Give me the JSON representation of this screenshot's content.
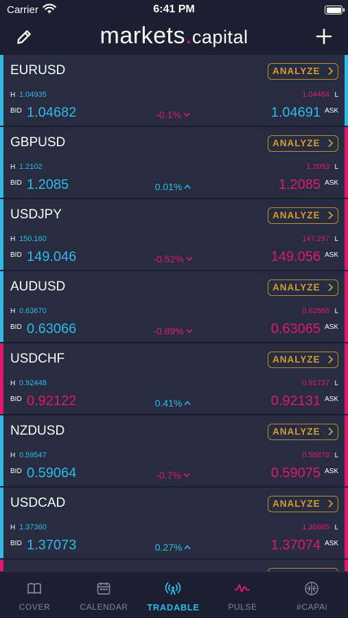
{
  "status": {
    "carrier": "Carrier",
    "time": "6:41 PM"
  },
  "header": {
    "logo_main": "markets",
    "logo_dot": ".",
    "logo_sub": "capital",
    "edit_icon": "pencil-icon",
    "add_icon": "plus-icon"
  },
  "colors": {
    "up": "#33b7e6",
    "down": "#e4186a",
    "accent": "#d99a30"
  },
  "labels": {
    "analyze": "ANALYZE",
    "high": "H",
    "low": "L",
    "bid": "BID",
    "ask": "ASK"
  },
  "pairs": [
    {
      "symbol": "EURUSD",
      "high": "1.04935",
      "low": "1.04484",
      "bid": "1.04682",
      "ask": "1.04691",
      "change": "-0.1%",
      "dir": "down",
      "bid_color": "up",
      "ask_color": "up",
      "left_bar": "up",
      "right_bar": "up"
    },
    {
      "symbol": "GBPUSD",
      "high": "1.2102",
      "low": "1.2053",
      "bid": "1.2085",
      "ask": "1.2085",
      "change": "0.01%",
      "dir": "up",
      "bid_color": "up",
      "ask_color": "down",
      "left_bar": "up",
      "right_bar": "down"
    },
    {
      "symbol": "USDJPY",
      "high": "150.160",
      "low": "147.297",
      "bid": "149.046",
      "ask": "149.056",
      "change": "-0.52%",
      "dir": "down",
      "bid_color": "up",
      "ask_color": "down",
      "left_bar": "up",
      "right_bar": "down"
    },
    {
      "symbol": "AUDUSD",
      "high": "0.63670",
      "low": "0.62868",
      "bid": "0.63066",
      "ask": "0.63065",
      "change": "-0.89%",
      "dir": "down",
      "bid_color": "up",
      "ask_color": "down",
      "left_bar": "up",
      "right_bar": "down"
    },
    {
      "symbol": "USDCHF",
      "high": "0.92448",
      "low": "0.91737",
      "bid": "0.92122",
      "ask": "0.92131",
      "change": "0.41%",
      "dir": "up",
      "bid_color": "down",
      "ask_color": "down",
      "left_bar": "down",
      "right_bar": "down"
    },
    {
      "symbol": "NZDUSD",
      "high": "0.59547",
      "low": "0.58878",
      "bid": "0.59064",
      "ask": "0.59075",
      "change": "-0.7%",
      "dir": "down",
      "bid_color": "up",
      "ask_color": "down",
      "left_bar": "up",
      "right_bar": "down"
    },
    {
      "symbol": "USDCAD",
      "high": "1.37360",
      "low": "1.36685",
      "bid": "1.37073",
      "ask": "1.37074",
      "change": "0.27%",
      "dir": "up",
      "bid_color": "up",
      "ask_color": "down",
      "left_bar": "up",
      "right_bar": "down"
    },
    {
      "symbol": "",
      "high": "",
      "low": "",
      "bid": "",
      "ask": "",
      "change": "",
      "dir": "up",
      "bid_color": "up",
      "ask_color": "down",
      "left_bar": "down",
      "right_bar": "down"
    }
  ],
  "tabs": [
    {
      "label": "COVER",
      "icon": "book-icon",
      "active": false
    },
    {
      "label": "CALENDAR",
      "icon": "calendar-icon",
      "active": false
    },
    {
      "label": "TRADABLE",
      "icon": "broadcast-icon",
      "active": true
    },
    {
      "label": "PULSE",
      "icon": "pulse-icon",
      "active": false
    },
    {
      "label": "#CAPAi",
      "icon": "brain-icon",
      "active": false
    }
  ]
}
